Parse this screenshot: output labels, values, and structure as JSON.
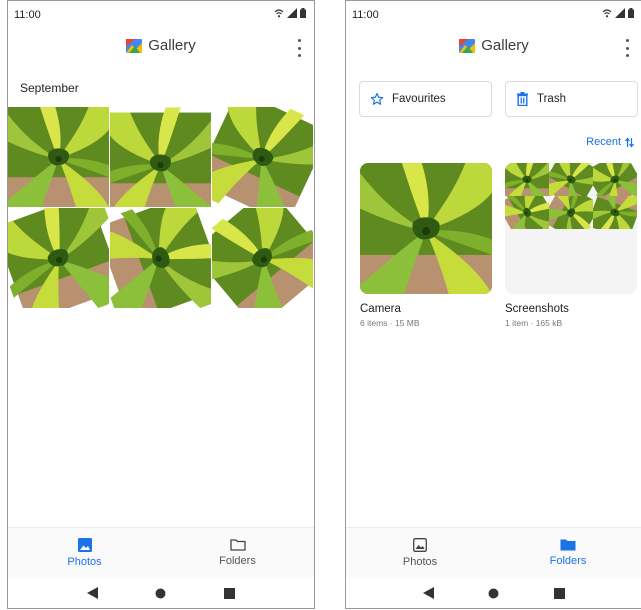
{
  "left_screen": {
    "status": {
      "time": "11:00"
    },
    "appbar": {
      "title": "Gallery"
    },
    "section_label": "September",
    "nav": {
      "photos_label": "Photos",
      "folders_label": "Folders",
      "active": "photos"
    }
  },
  "right_screen": {
    "status": {
      "time": "11:00"
    },
    "appbar": {
      "title": "Gallery"
    },
    "chips": {
      "favourites": "Favourites",
      "trash": "Trash"
    },
    "recent_label": "Recent",
    "albums": [
      {
        "name": "Camera",
        "meta": "6 items · 15 MB"
      },
      {
        "name": "Screenshots",
        "meta": "1 item · 165 kB"
      }
    ],
    "nav": {
      "photos_label": "Photos",
      "folders_label": "Folders",
      "active": "folders"
    }
  },
  "icons": {
    "status": [
      "wifi-icon",
      "signal-icon",
      "battery-icon"
    ],
    "appbar": [
      "gallery-logo-icon",
      "more-vert-icon"
    ],
    "nav": [
      "photos-icon",
      "folder-icon"
    ],
    "sysnav": [
      "back-icon",
      "home-icon",
      "recents-icon"
    ],
    "chips": [
      "star-icon",
      "trash-icon"
    ],
    "recent": "sort-arrows-icon"
  },
  "colors": {
    "accent": "#1a73e8",
    "plant_light": "#c6dc3a",
    "plant_mid": "#7fb02c",
    "plant_dark": "#2f5a12",
    "soil": "#b89170"
  }
}
